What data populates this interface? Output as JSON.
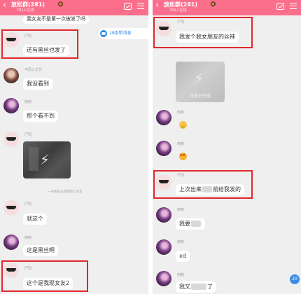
{
  "header": {
    "title": "放松群(281)",
    "subtitle": "791人在线"
  },
  "left": {
    "top_text": "我女友不是第一次被发了吗",
    "new_msg": "28条新消息",
    "messages": [
      {
        "name": "尸同",
        "text": "还有黑丝也发了"
      },
      {
        "name": "不忍心文艺",
        "text": "我没看到"
      },
      {
        "name": "刺刺",
        "text": "那个看不到"
      },
      {
        "name": "尸同",
        "image": true
      },
      {
        "system": "一条图表消息撤销了消息"
      },
      {
        "name": "尸同",
        "text": "就这个"
      },
      {
        "name": "刺刺",
        "text": "这是黑丝啊"
      },
      {
        "name": "尸同",
        "text": "这个是我现女友2"
      }
    ]
  },
  "right": {
    "messages": [
      {
        "name": "尸同",
        "text": "我发个我女朋友的丝袜"
      },
      {
        "image_caption": "可能已失败"
      },
      {
        "name": "刺刺",
        "emoji": "smile"
      },
      {
        "name": "刺刺",
        "emoji": "hearts"
      },
      {
        "name": "尸同",
        "text_a": "上次出来",
        "text_b": "前给我发的"
      },
      {
        "name": "刺刺",
        "text_a": "我要"
      },
      {
        "name": "刺刺",
        "text_a": "xd"
      },
      {
        "name": "刺刺",
        "text_a": "我又",
        "text_b": "了"
      }
    ],
    "badge": "20"
  }
}
